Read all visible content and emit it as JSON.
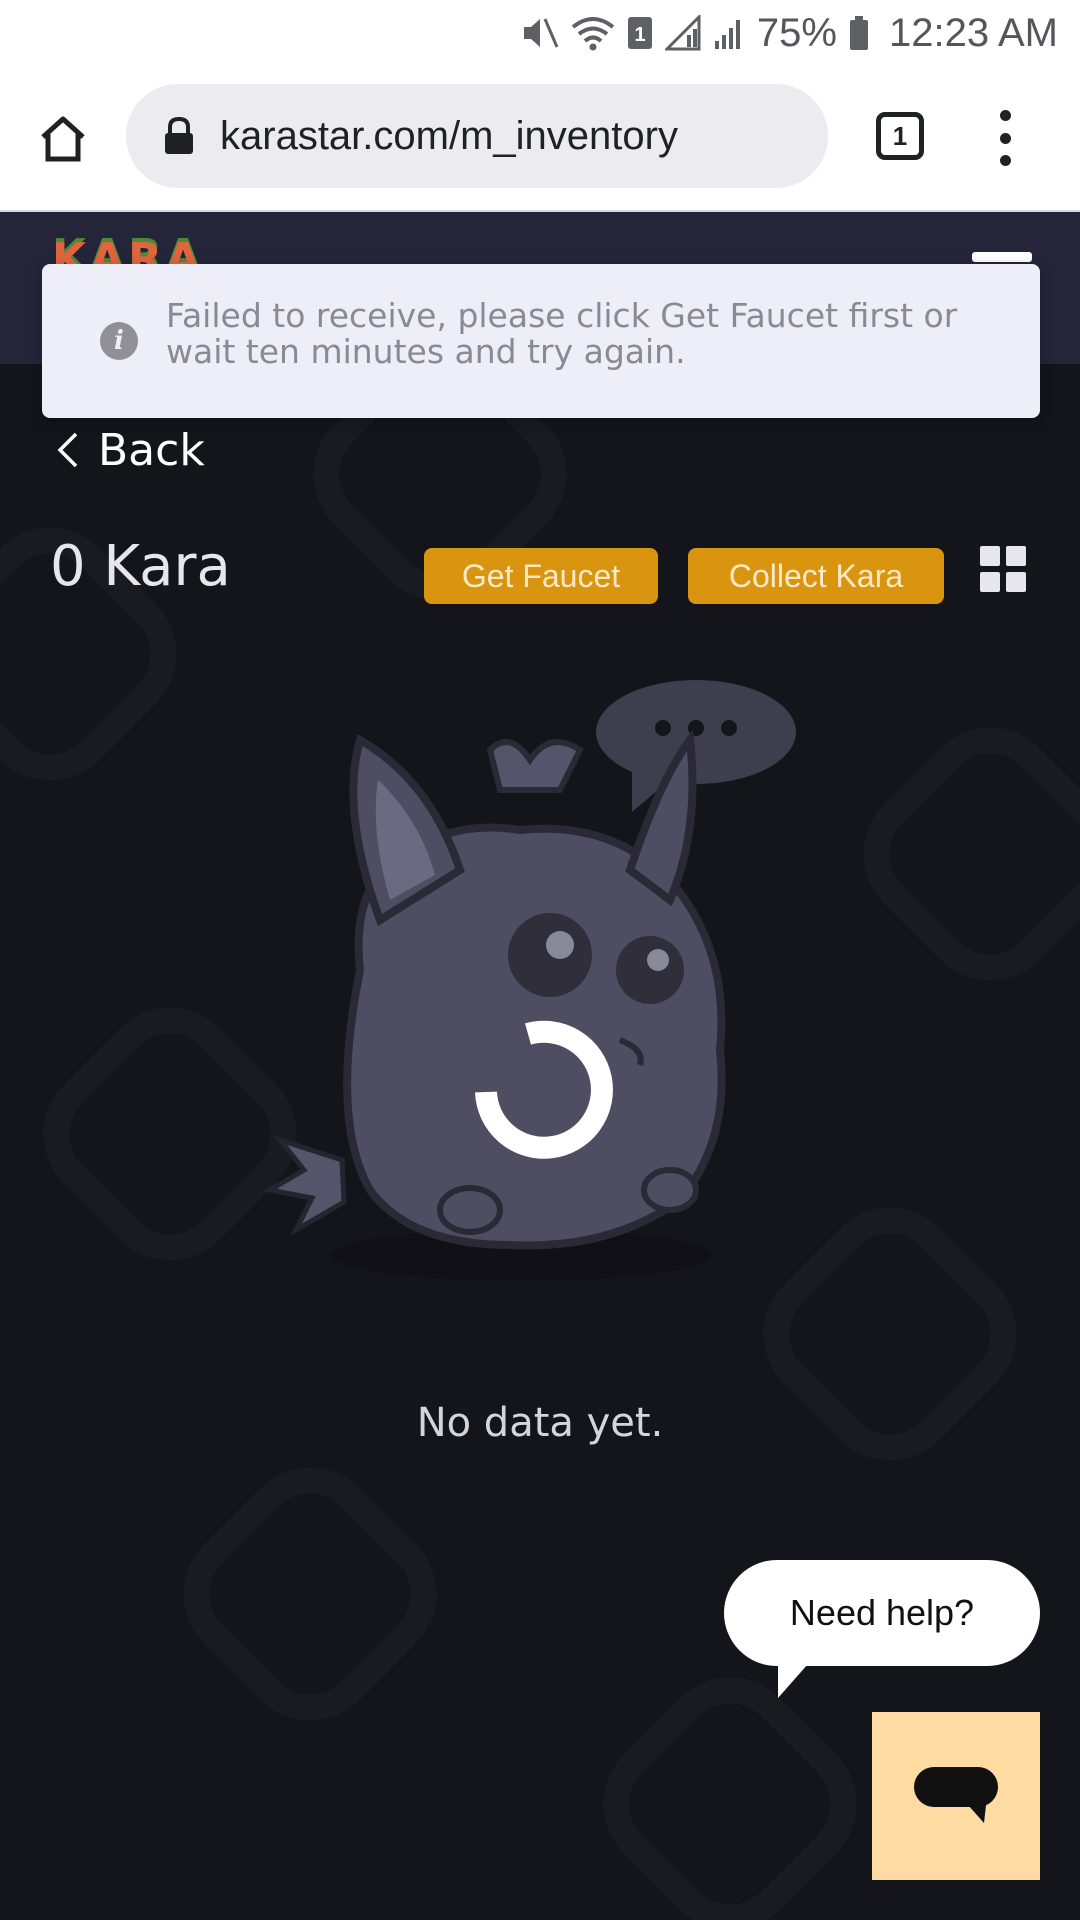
{
  "status_bar": {
    "battery": "75%",
    "time": "12:23 AM",
    "icons": [
      "mute-icon",
      "wifi-icon",
      "sim-icon",
      "signal-icon",
      "signal-icon",
      "battery-icon"
    ]
  },
  "browser": {
    "url": "karastar.com/m_inventory",
    "tab_count": "1"
  },
  "alert": {
    "message": "Failed to receive, please click Get Faucet first or wait ten minutes and try again."
  },
  "nav": {
    "back_label": "Back"
  },
  "balance": {
    "text": "0 Kara"
  },
  "actions": {
    "get_faucet": "Get Faucet",
    "collect_kara": "Collect Kara"
  },
  "empty_state": {
    "text": "No data yet."
  },
  "help": {
    "bubble_text": "Need help?"
  },
  "colors": {
    "accent": "#d9950f",
    "header_bg": "#25253a",
    "page_bg": "#14141b",
    "chat_launcher": "#fddba2"
  }
}
